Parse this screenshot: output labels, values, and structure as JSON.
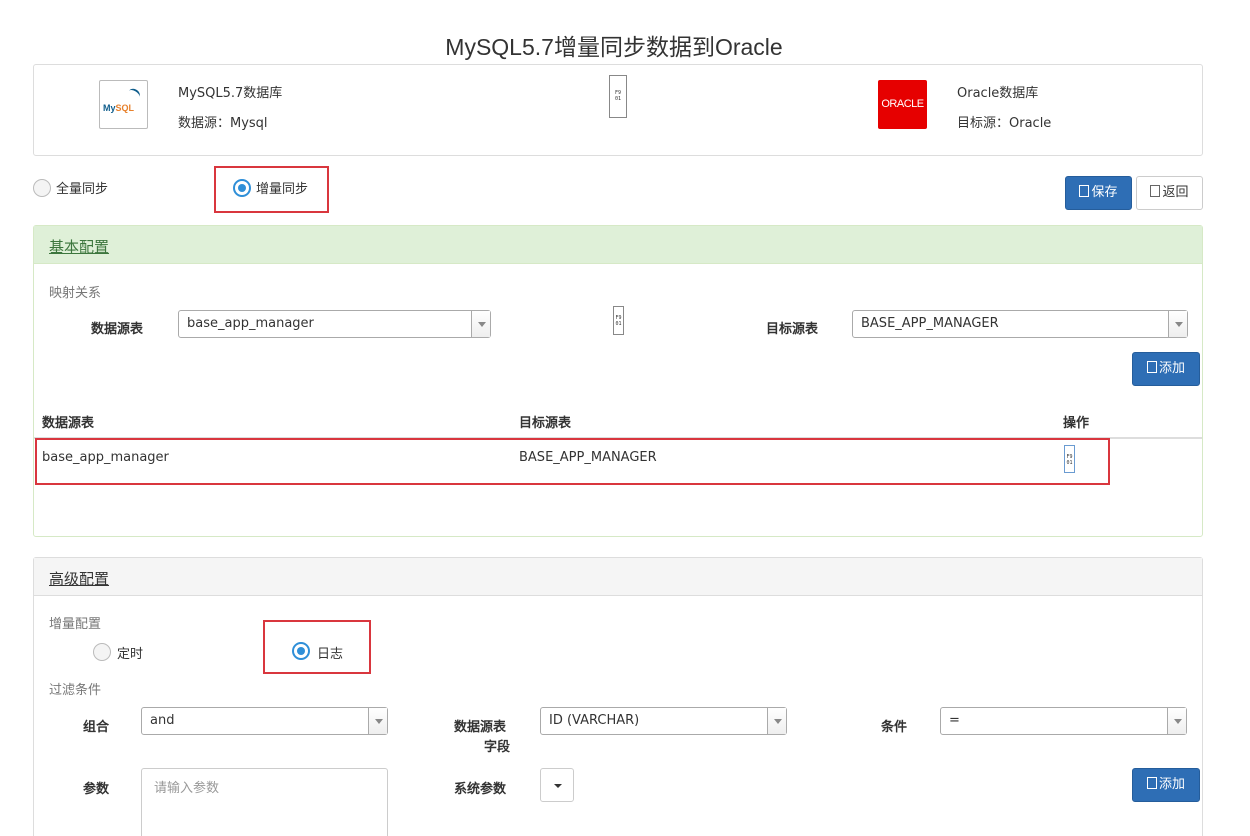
{
  "title": "MySQL5.7增量同步数据到Oracle",
  "source": {
    "logo_text_1": "My",
    "logo_text_2": "SQL",
    "name": "MySQL5.7数据库",
    "datasource": "数据源：Mysql"
  },
  "target": {
    "logo_text": "ORACLE",
    "name": "Oracle数据库",
    "datasource": "目标源：Oracle"
  },
  "arrow_glyph": "F9\n01",
  "sync_mode": {
    "full_label": "全量同步",
    "incremental_label": "增量同步",
    "selected": "incremental"
  },
  "toolbar": {
    "save_label": "保存",
    "back_label": "返回"
  },
  "basic": {
    "title": "基本配置",
    "mapping_label": "映射关系",
    "source_table_label": "数据源表",
    "source_table_value": "base_app_manager",
    "target_table_label": "目标源表",
    "target_table_value": "BASE_APP_MANAGER",
    "add_label": "添加",
    "table": {
      "headers": [
        "数据源表",
        "目标源表",
        "操作"
      ],
      "rows": [
        {
          "source": "base_app_manager",
          "target": "BASE_APP_MANAGER"
        }
      ]
    }
  },
  "advanced": {
    "title": "高级配置",
    "increment_label": "增量配置",
    "timer_label": "定时",
    "log_label": "日志",
    "selected": "log",
    "filter_label": "过滤条件",
    "combo_label": "组合",
    "combo_value": "and",
    "field_label_1": "数据源表",
    "field_label_2": "字段",
    "field_value": "ID (VARCHAR)",
    "condition_label": "条件",
    "condition_value": "=",
    "param_label": "参数",
    "param_placeholder": "请输入参数",
    "sys_param_label": "系统参数",
    "add_label": "添加"
  },
  "colors": {
    "primary": "#2e6eb5",
    "highlight": "#d9363e",
    "radio_on": "#2f8fd8",
    "green_head": "#dff0d8"
  }
}
